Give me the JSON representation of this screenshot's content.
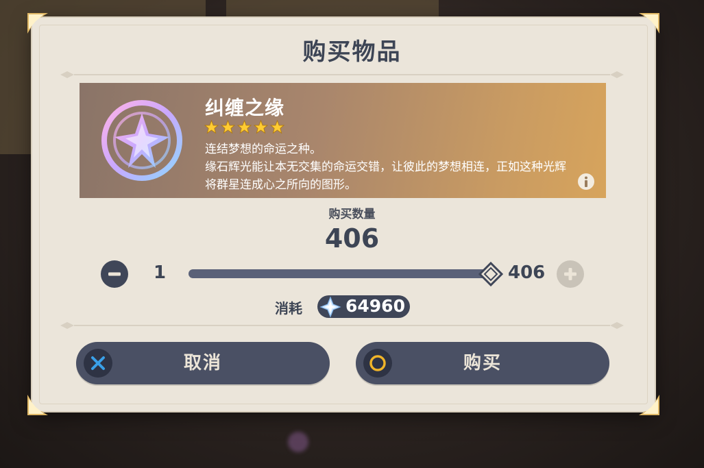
{
  "dialog": {
    "title": "购买物品"
  },
  "item": {
    "icon": "intertwined-fate-icon",
    "name": "纠缠之缘",
    "rarity_stars": 5,
    "description_line1": "连结梦想的命运之种。",
    "description_line2": "缘石辉光能让本无交集的命运交错，让彼此的梦想相连，正如这种光辉将群星连成心之所向的图形。",
    "info_icon": "info-icon"
  },
  "quantity": {
    "label": "购买数量",
    "value": "406",
    "min": "1",
    "max": "406",
    "slider_fraction": 1.0
  },
  "cost": {
    "label": "消耗",
    "currency_icon": "primogem-icon",
    "value": "64960"
  },
  "buttons": {
    "cancel_label": "取消",
    "cancel_icon": "x-icon",
    "buy_label": "购买",
    "buy_icon": "circle-icon"
  },
  "colors": {
    "panel": "#ebe5da",
    "dark_button": "#4a5064",
    "title_text": "#3d4555",
    "star": "#ffcc33",
    "x_icon": "#3aa0e8",
    "o_icon": "#f0b429"
  }
}
